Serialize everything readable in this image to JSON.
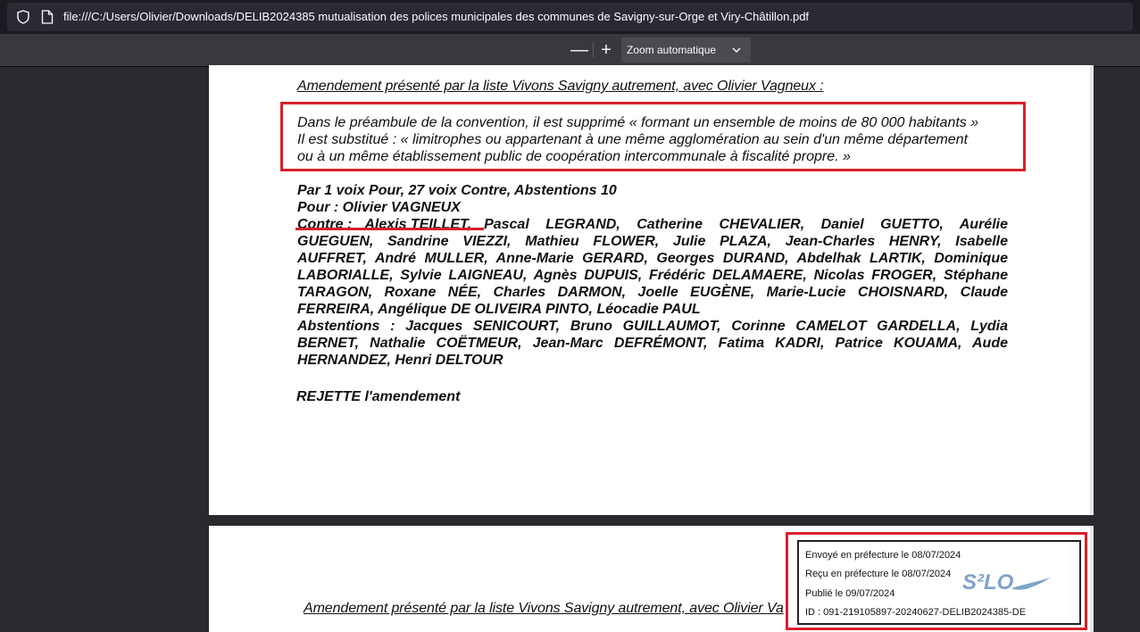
{
  "browser": {
    "url": "file:///C:/Users/Olivier/Downloads/DELIB2024385 mutualisation des polices municipales des communes de Savigny-sur-Orge et Viry-Châtillon.pdf"
  },
  "pdf_toolbar": {
    "zoom_out": "—",
    "zoom_in": "+",
    "zoom_value": "Zoom automatique"
  },
  "page1": {
    "heading": "Amendement présenté par la liste Vivons Savigny autrement, avec Olivier Vagneux :",
    "amendment_lines": [
      "Dans le préambule de la convention, il est supprimé « formant un ensemble de moins de 80 000 habitants »",
      "Il est substitué : « limitrophes ou appartenant à une même agglomération au sein d'un même département",
      "ou à un même établissement public de coopération intercommunale à fiscalité propre. »"
    ],
    "vote_summary": "Par 1 voix Pour, 27 voix Contre, Abstentions 10",
    "pour_line": "Pour : Olivier VAGNEUX",
    "contre_label": "Contre :",
    "contre_first": "Alexis TEILLET,",
    "contre_lines": [
      "Pascal LEGRAND, Catherine CHEVALIER, Daniel GUETTO, Aurélie",
      "GUEGUEN, Sandrine VIEZZI, Mathieu FLOWER, Julie PLAZA, Jean-Charles HENRY, Isabelle",
      "AUFFRET, André MULLER, Anne-Marie GERARD, Georges DURAND, Abdelhak LARTIK, Dominique",
      "LABORIALLE, Sylvie LAIGNEAU, Agnès DUPUIS, Frédéric DELAMAERE, Nicolas FROGER, Stéphane",
      "TARAGON, Roxane NÉE, Charles DARMON, Joelle EUGÈNE, Marie-Lucie CHOISNARD, Claude",
      "FERREIRA, Angélique DE OLIVEIRA PINTO, Léocadie PAUL"
    ],
    "abstentions_lines": [
      "Abstentions : Jacques SENICOURT, Bruno GUILLAUMOT, Corinne CAMELOT GARDELLA, Lydia",
      "BERNET, Nathalie COËTMEUR, Jean-Marc DEFRÉMONT, Fatima KADRI, Patrice KOUAMA, Aude",
      "HERNANDEZ, Henri DELTOUR"
    ],
    "decision": "REJETTE l'amendement"
  },
  "page2": {
    "heading": "Amendement présenté par la liste Vivons Savigny autrement, avec Olivier Va",
    "stamp": {
      "sent": "Envoyé en préfecture le 08/07/2024",
      "received": "Reçu en préfecture le 08/07/2024",
      "published": "Publié le 09/07/2024",
      "id": "ID : 091-219105897-20240627-DELIB2024385-DE",
      "logo": "S²LO"
    }
  },
  "colors": {
    "annotation_red": "#d8202a",
    "viewer_bg": "#2a2a2e",
    "toolbar_bg": "#38383d"
  }
}
